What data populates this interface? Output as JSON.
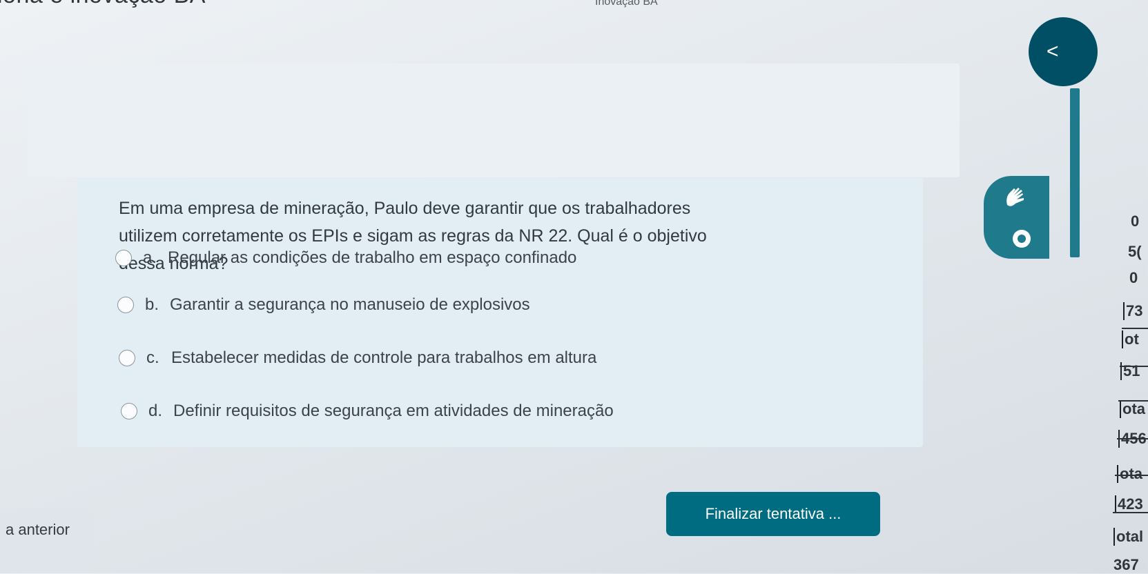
{
  "breadcrumb": {
    "left_text": "iona e inovação BA",
    "right_text": "Inovação BA"
  },
  "question": {
    "text": "Em uma empresa de mineração, Paulo deve garantir que os trabalhadores utilizem corretamente os EPIs e sigam as regras da NR 22. Qual é o objetivo dessa norma?",
    "options": [
      {
        "letter": "a.",
        "label": "Regular as condições de trabalho em espaço confinado"
      },
      {
        "letter": "b.",
        "label": "Garantir a segurança no manuseio de explosivos"
      },
      {
        "letter": "c.",
        "label": "Estabelecer medidas de controle para trabalhos em altura"
      },
      {
        "letter": "d.",
        "label": "Definir requisitos de segurança em atividades de mineração"
      }
    ]
  },
  "buttons": {
    "finish_label": "Finalizar tentativa ...",
    "previous_label": "a anterior",
    "nav_glyph": "<"
  },
  "grade_panel": {
    "items": [
      "0",
      "5(",
      "0",
      "73",
      "ot",
      "51",
      "ota",
      "456",
      "ota",
      "423",
      "otal",
      "367"
    ]
  },
  "icons": {
    "nav": "chevron-left-icon",
    "accessibility": "sign-language-hand-icon",
    "vision": "vision-icon"
  },
  "colors": {
    "accent": "#006c82",
    "fab": "#1f7a8c",
    "nav": "#004f64"
  }
}
